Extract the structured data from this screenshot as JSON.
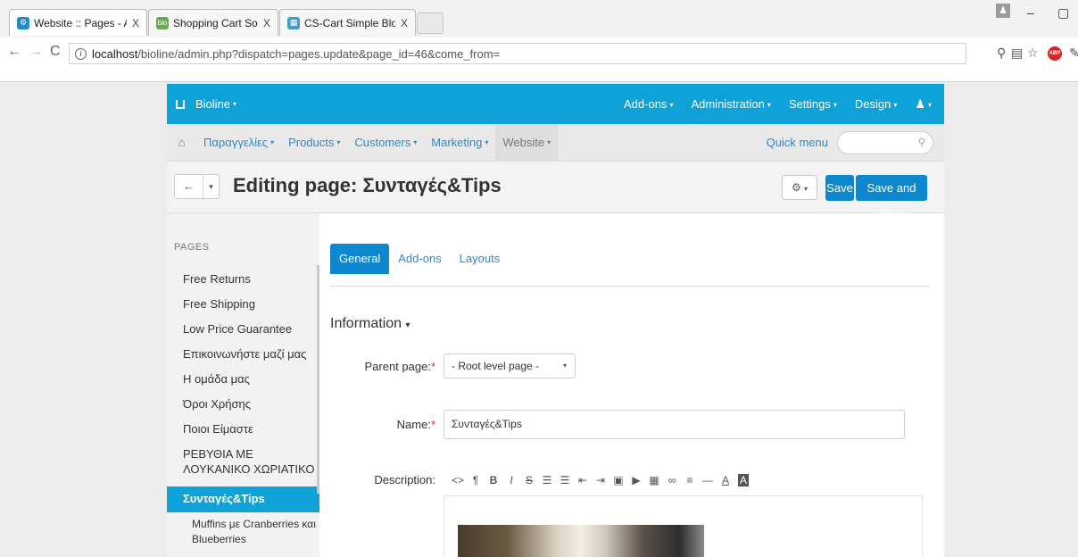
{
  "browser": {
    "tabs": [
      {
        "label": "Website :: Pages - Admin",
        "favicon": "cs-cart-icon",
        "active": true
      },
      {
        "label": "Shopping Cart Software",
        "favicon": "bio-icon",
        "active": false
      },
      {
        "label": "CS-Cart Simple Blog Add",
        "favicon": "blog-icon",
        "active": false
      }
    ],
    "url_host": "localhost",
    "url_path": "/bioline/admin.php?dispatch=pages.update&page_id=46&come_from=",
    "abp_label": "ABP"
  },
  "topnav": {
    "brand": "Bioline",
    "menus": [
      "Add-ons",
      "Administration",
      "Settings",
      "Design"
    ]
  },
  "subnav": {
    "items": [
      "Παραγγελίες",
      "Products",
      "Customers",
      "Marketing",
      "Website"
    ],
    "quick_menu": "Quick menu"
  },
  "actionbar": {
    "title": "Editing page: Συνταγές&Tips",
    "save": "Save",
    "save_close": "Save and close"
  },
  "sidebar": {
    "title": "PAGES",
    "items": [
      "Free Returns",
      "Free Shipping",
      "Low Price Guarantee",
      "Επικοινωνήστε μαζί μας",
      "Η ομάδα μας",
      "Όροι Χρήσης",
      "Ποιοι Είμαστε",
      "ΡΕΒΥΘΙΑ ΜΕ ΛΟΥΚΑΝΙΚΟ ΧΩΡΙΑΤΙΚΟ"
    ],
    "active": "Συνταγές&Tips",
    "sub_item": "Muffins με Cranberries και Blueberries"
  },
  "main": {
    "tabs": [
      "General",
      "Add-ons",
      "Layouts"
    ],
    "section": "Information",
    "parent_label": "Parent page:",
    "parent_value": "- Root level page -",
    "name_label": "Name:",
    "name_value": "Συνταγές&Tips",
    "description_label": "Description:"
  },
  "colors": {
    "header_blue": "#0fa2d8",
    "button_blue": "#0d88cf",
    "link_blue": "#2e89c6"
  }
}
